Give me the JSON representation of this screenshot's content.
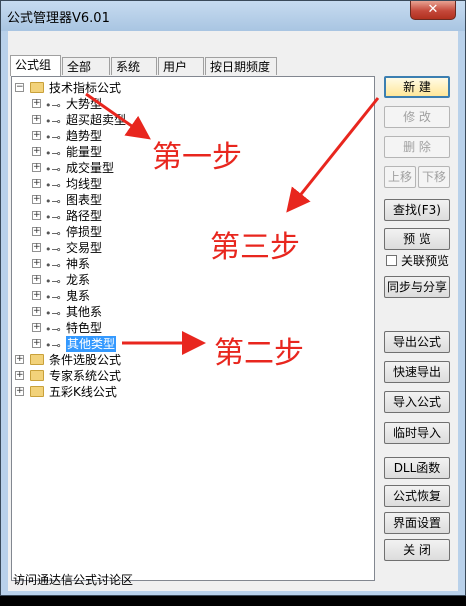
{
  "window": {
    "title": "公式管理器V6.01",
    "close_glyph": "✕"
  },
  "tabs": [
    "公式组",
    "全部",
    "系统",
    "用户",
    "按日期频度"
  ],
  "tree": {
    "root_items": [
      {
        "label": "技术指标公式",
        "expanded": true
      },
      {
        "label": "条件选股公式",
        "expanded": false
      },
      {
        "label": "专家系统公式",
        "expanded": false
      },
      {
        "label": "五彩K线公式",
        "expanded": false
      }
    ],
    "children": [
      "大势型",
      "超买超卖型",
      "趋势型",
      "能量型",
      "成交量型",
      "均线型",
      "图表型",
      "路径型",
      "停损型",
      "交易型",
      "神系",
      "龙系",
      "鬼系",
      "其他系",
      "特色型",
      "其他类型"
    ],
    "selected": "其他类型"
  },
  "buttons": {
    "new": "新  建",
    "modify": "修  改",
    "delete": "删  除",
    "up": "上移",
    "down": "下移",
    "find": "查找(F3)",
    "preview": "预  览",
    "preview_check": "关联预览",
    "sync": "同步与分享",
    "export": "导出公式",
    "quick_export": "快速导出",
    "import": "导入公式",
    "temp_import": "临时导入",
    "dll": "DLL函数",
    "restore": "公式恢复",
    "ui_settings": "界面设置",
    "close": "关  闭"
  },
  "status_text": "访问通达信公式讨论区",
  "annotations": {
    "step1": "第一步",
    "step2": "第二步",
    "step3": "第三步"
  },
  "colors": {
    "annotation": "#e8261e",
    "selection": "#3399ff"
  }
}
